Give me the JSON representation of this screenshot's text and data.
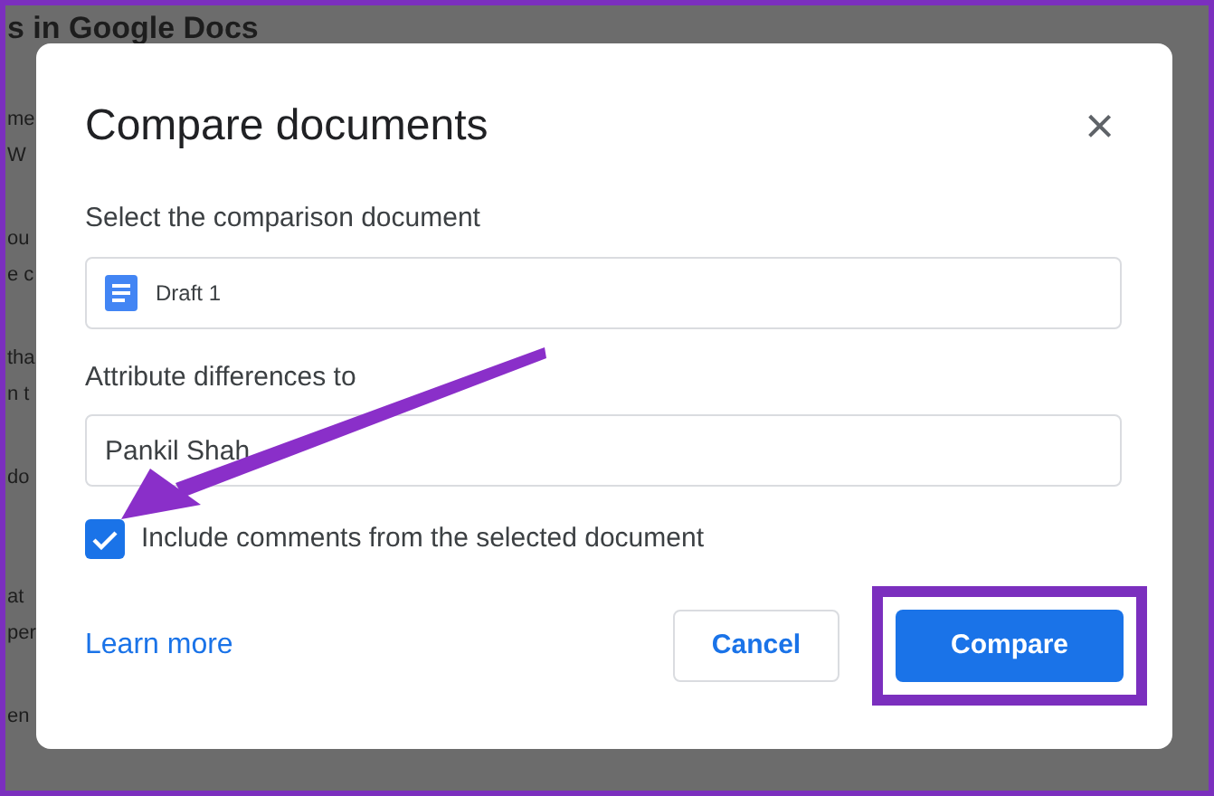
{
  "background_page": {
    "heading": "s in Google Docs",
    "paragraphs": [
      [
        "me",
        "W"
      ],
      [
        "ou",
        "e c"
      ],
      [
        "tha",
        "n t"
      ],
      [
        "do"
      ],
      [
        "at",
        "per"
      ],
      [
        "en"
      ]
    ]
  },
  "dialog": {
    "title": "Compare documents",
    "close": "×",
    "document_label": "Select the comparison document",
    "document": "Draft 1",
    "attribute_label": "Attribute differences to",
    "attribute_value": "Pankil Shah",
    "include_comments": {
      "label": "Include comments from the selected document",
      "checked": true
    },
    "learn_more": "Learn more",
    "buttons": [
      {
        "label": "Cancel",
        "kind": "secondary",
        "highlighted": false
      },
      {
        "label": "Compare",
        "kind": "primary",
        "highlighted": true
      }
    ]
  },
  "annotations": [
    {
      "kind": "arrow"
    }
  ]
}
